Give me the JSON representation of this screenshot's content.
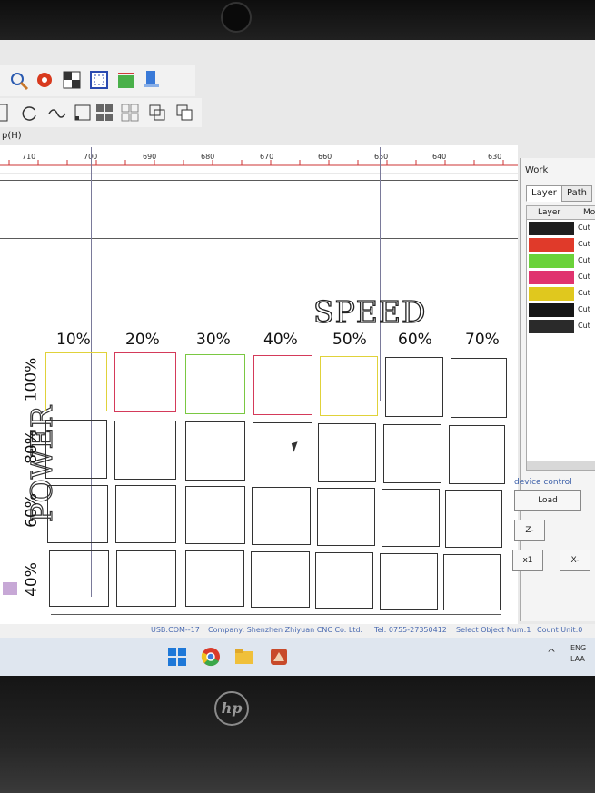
{
  "menu": {
    "fragment": "p(H)"
  },
  "ruler": {
    "labels": [
      "710",
      "700",
      "690",
      "680",
      "670",
      "660",
      "650",
      "640",
      "630"
    ]
  },
  "canvas": {
    "speed_text": "SPEED",
    "power_text": "POWER",
    "speed_percents": [
      "10%",
      "20%",
      "30%",
      "40%",
      "50%",
      "60%",
      "70%"
    ],
    "power_percents": [
      "100%",
      "80%",
      "60%",
      "40%"
    ]
  },
  "panel": {
    "title": "Work",
    "tabs": [
      "Layer",
      "Path"
    ],
    "layer_header": "Layer",
    "mode_header": "Mo",
    "layers": [
      {
        "color": "#1e1e1e",
        "mode": "Cut"
      },
      {
        "color": "#e03a2a",
        "mode": "Cut"
      },
      {
        "color": "#6bd23a",
        "mode": "Cut"
      },
      {
        "color": "#e0336e",
        "mode": "Cut"
      },
      {
        "color": "#e0c81e",
        "mode": "Cut"
      },
      {
        "color": "#161616",
        "mode": "Cut"
      },
      {
        "color": "#2a2a2a",
        "mode": "Cut"
      }
    ],
    "device_control": "device control",
    "load_label": "Load",
    "z_label": "Z-",
    "x1_label": "x1",
    "x_label": "X-"
  },
  "status": {
    "port": "USB:COM--17",
    "company": "Company: Shenzhen Zhiyuan CNC Co. Ltd.",
    "tel": "Tel: 0755-27350412",
    "select": "Select Object Num:1",
    "count": "Count Unit:0"
  },
  "taskbar": {
    "lang1": "ENG",
    "lang2": "LAA"
  },
  "colors": {
    "accent": "#3a5ea8",
    "grid_yellow": "#e0d23a",
    "grid_red": "#d43a5a",
    "grid_green": "#7ac842"
  }
}
